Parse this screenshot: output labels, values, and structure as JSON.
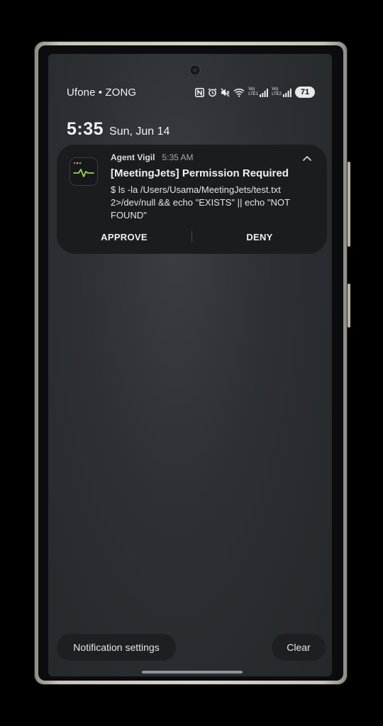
{
  "status_bar": {
    "carrier": "Ufone • ZONG",
    "icons": [
      "nfc-icon",
      "alarm-icon",
      "mute-icon",
      "wifi-icon",
      "volte-lte1-signal-icon",
      "volte-lte2-signal-icon"
    ],
    "lte1_label": "LTE1",
    "lte2_label": "LTE2",
    "volte_label": "Vo)",
    "battery": "71"
  },
  "lockscreen": {
    "time": "5:35",
    "date": "Sun, Jun 14"
  },
  "notification": {
    "app_name": "Agent Vigil",
    "time": "5:35 AM",
    "title": "[MeetingJets] Permission Required",
    "body": "$ ls -la /Users/Usama/MeetingJets/test.txt 2>/dev/null && echo \"EXISTS\" || echo \"NOT FOUND\"",
    "app_icon": "activity-monitor-icon",
    "collapse_icon": "chevron-up-icon",
    "actions": {
      "approve": "APPROVE",
      "deny": "DENY"
    }
  },
  "bottom": {
    "settings_label": "Notification settings",
    "clear_label": "Clear"
  },
  "colors": {
    "background": "#2c2f33",
    "notification_bg": "#1b1c1e",
    "pulse_green": "#9bd15a",
    "frame": "#d8d3c7"
  }
}
